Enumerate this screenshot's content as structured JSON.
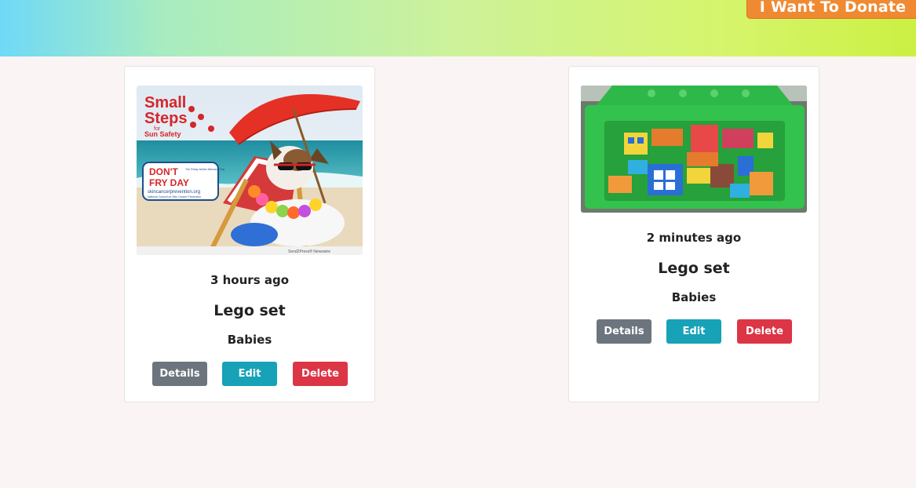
{
  "header": {
    "donate_label": "I Want To Donate"
  },
  "cards": [
    {
      "time": "3 hours ago",
      "title": "Lego set",
      "category": "Babies",
      "image_text": {
        "headline_1": "Small",
        "headline_2": "Steps",
        "headline_for": "for",
        "headline_3": "Sun Safety",
        "badge_1": "DON'T",
        "badge_2": "FRY DAY",
        "badge_sub": "The Friday before Memorial Day",
        "badge_url": "skincancerprevention.org",
        "badge_org": "National Council on Skin Cancer Prevention",
        "credit": "Send2Press® Newswire"
      },
      "buttons": {
        "details": "Details",
        "edit": "Edit",
        "delete": "Delete"
      }
    },
    {
      "time": "2 minutes ago",
      "title": "Lego set",
      "category": "Babies",
      "buttons": {
        "details": "Details",
        "edit": "Edit",
        "delete": "Delete"
      }
    }
  ],
  "colors": {
    "details": "#6c757d",
    "edit": "#17a2b8",
    "delete": "#dc3545",
    "donate": "#ef8a32"
  }
}
